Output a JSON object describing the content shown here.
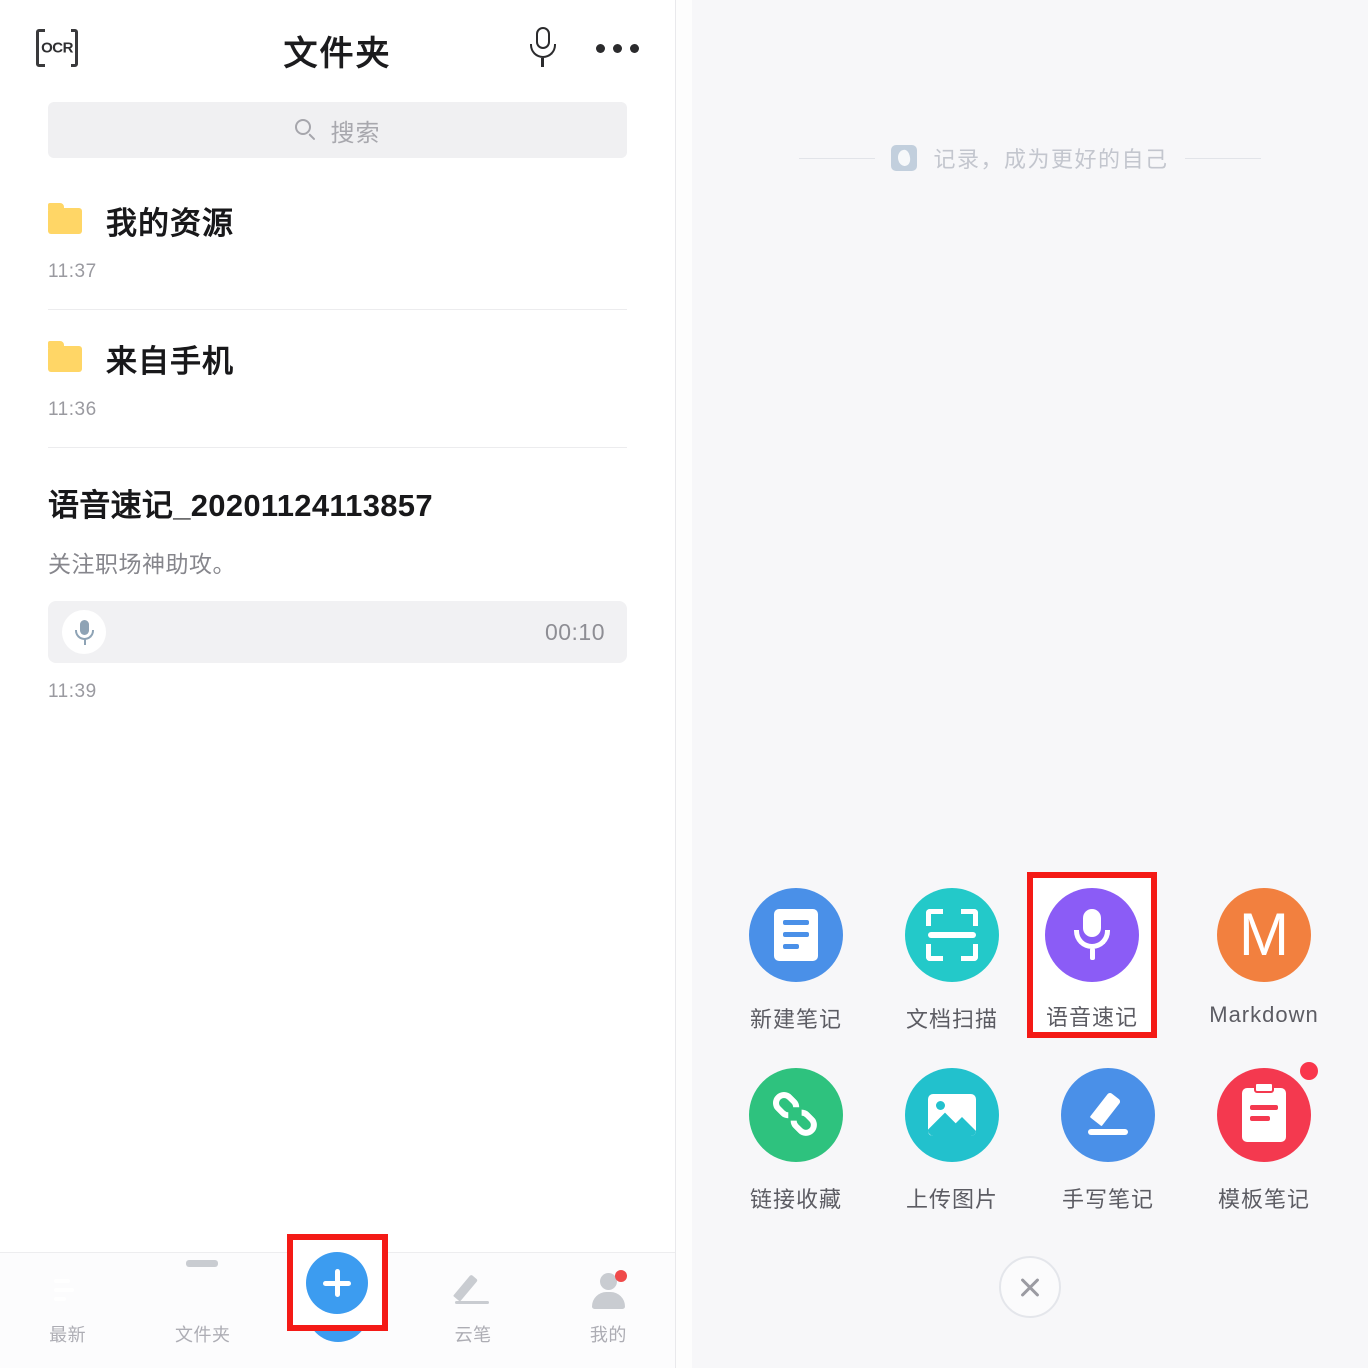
{
  "left": {
    "header": {
      "ocr_icon_label": "OCR",
      "title": "文件夹",
      "mic_icon": "microphone-icon",
      "more_icon": "more-options-icon"
    },
    "search": {
      "placeholder": "搜索",
      "icon": "search-icon"
    },
    "items": [
      {
        "type": "folder",
        "name": "我的资源",
        "time": "11:37"
      },
      {
        "type": "folder",
        "name": "来自手机",
        "time": "11:36"
      },
      {
        "type": "note",
        "title": "语音速记_20201124113857",
        "subtitle": "关注职场神助攻。",
        "audio_duration": "00:10",
        "time": "11:39"
      }
    ],
    "nav": [
      {
        "label": "最新",
        "icon": "latest-icon",
        "badge": false
      },
      {
        "label": "文件夹",
        "icon": "folder-icon",
        "badge": false
      },
      {
        "label": "",
        "icon": "plus-fab-icon",
        "badge": false
      },
      {
        "label": "云笔",
        "icon": "pen-icon",
        "badge": false
      },
      {
        "label": "我的",
        "icon": "user-icon",
        "badge": true
      }
    ]
  },
  "right": {
    "tagline": "记录，成为更好的自己",
    "tagline_logo": "elephant-logo-icon",
    "actions": [
      {
        "label": "新建笔记",
        "icon": "new-note-icon",
        "color": "#4a90e8",
        "badge": false,
        "highlighted": false
      },
      {
        "label": "文档扫描",
        "icon": "document-scan-icon",
        "color": "#23c9c9",
        "badge": false,
        "highlighted": false
      },
      {
        "label": "语音速记",
        "icon": "voice-memo-icon",
        "color": "#8b5cf6",
        "badge": false,
        "highlighted": true
      },
      {
        "label": "Markdown",
        "icon": "markdown-icon",
        "color": "#f2803f",
        "badge": false,
        "highlighted": false
      },
      {
        "label": "链接收藏",
        "icon": "link-save-icon",
        "color": "#2ec27e",
        "badge": false,
        "highlighted": false
      },
      {
        "label": "上传图片",
        "icon": "upload-image-icon",
        "color": "#22c1cd",
        "badge": false,
        "highlighted": false
      },
      {
        "label": "手写笔记",
        "icon": "handwrite-note-icon",
        "color": "#4a90e8",
        "badge": false,
        "highlighted": false
      },
      {
        "label": "模板笔记",
        "icon": "template-note-icon",
        "color": "#f4394f",
        "badge": true,
        "highlighted": false
      }
    ],
    "close_icon": "close-icon"
  },
  "highlight_color": "#f41a16"
}
